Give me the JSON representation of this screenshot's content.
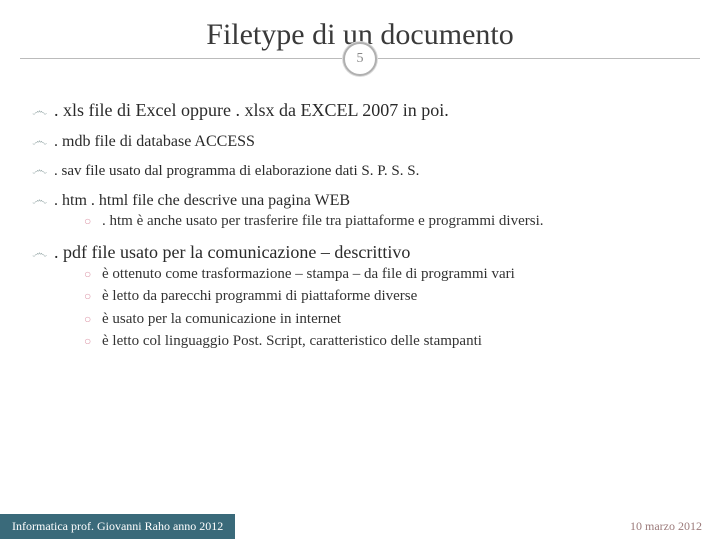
{
  "title": "Filetype di un documento",
  "page_number": "5",
  "items": [
    {
      "ext": ". xls",
      "desc": " file di Excel oppure  . xlsx da EXCEL 2007  in poi.",
      "cls": ""
    },
    {
      "ext": ". mdb",
      "desc": "  file di database ACCESS",
      "cls": "small"
    },
    {
      "ext": ". sav",
      "desc": "   file usato dal programma di elaborazione dati S. P. S. S.",
      "cls": "smaller"
    },
    {
      "ext": ". htm  . html",
      "desc": "  file che descrive una pagina WEB",
      "cls": "small",
      "sub": [
        {
          "t": "htm è anche usato per trasferire file tra piattaforme e programmi diversi.",
          "lead": ". "
        }
      ]
    },
    {
      "ext": ". pdf",
      "desc": "  file usato per la comunicazione – descrittivo",
      "cls": "",
      "sub": [
        {
          "t": "è ottenuto come trasformazione – stampa – da file di programmi vari"
        },
        {
          "t": "è letto da parecchi programmi di piattaforme diverse"
        },
        {
          "t": "è usato per la comunicazione in internet"
        },
        {
          "t": "è letto col linguaggio Post. Script, caratteristico delle stampanti"
        }
      ]
    }
  ],
  "footer": {
    "left": "Informatica prof. Giovanni Raho anno 2012",
    "right": "10 marzo 2012"
  }
}
